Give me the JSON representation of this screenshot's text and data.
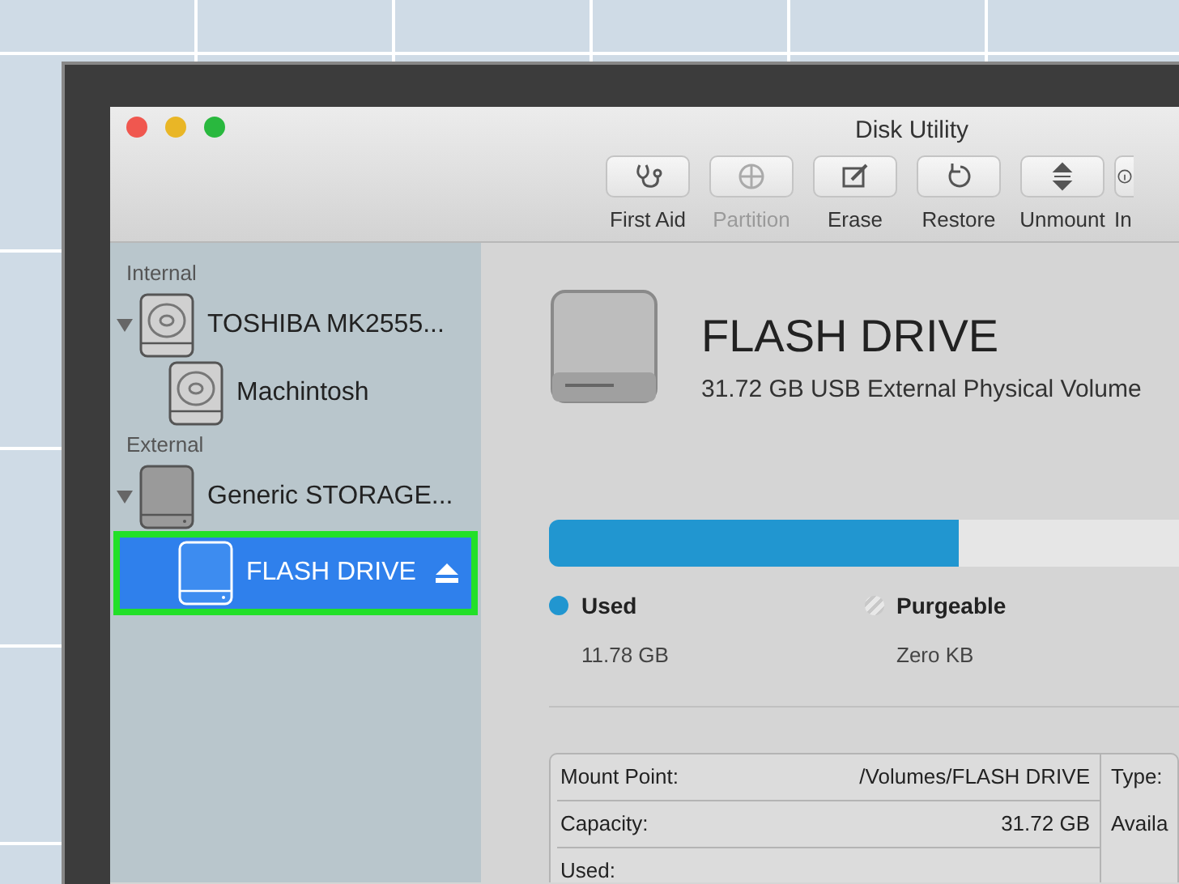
{
  "window": {
    "title": "Disk Utility"
  },
  "toolbar": [
    {
      "label": "First Aid",
      "kind": "firstaid",
      "disabled": false
    },
    {
      "label": "Partition",
      "kind": "partition",
      "disabled": true
    },
    {
      "label": "Erase",
      "kind": "erase",
      "disabled": false
    },
    {
      "label": "Restore",
      "kind": "restore",
      "disabled": false
    },
    {
      "label": "Unmount",
      "kind": "unmount",
      "disabled": false
    },
    {
      "label": "In",
      "kind": "info",
      "disabled": false
    }
  ],
  "sidebar": {
    "sections": [
      {
        "heading": "Internal",
        "items": [
          {
            "name": "TOSHIBA MK2555...",
            "kind": "hdd",
            "expanded": true,
            "selected": false,
            "children": [
              {
                "name": "Machintosh",
                "kind": "hdd",
                "selected": false,
                "ejectable": false
              }
            ]
          }
        ]
      },
      {
        "heading": "External",
        "items": [
          {
            "name": "Generic STORAGE...",
            "kind": "external",
            "expanded": true,
            "selected": false,
            "children": [
              {
                "name": "FLASH DRIVE",
                "kind": "external",
                "selected": true,
                "ejectable": true
              }
            ]
          }
        ]
      }
    ]
  },
  "volume": {
    "name": "FLASH DRIVE",
    "description": "31.72 GB USB External Physical Volume",
    "usage": {
      "level": 0.65
    },
    "legend": [
      {
        "label": "Used",
        "value": "11.78 GB",
        "kind": "solid",
        "color": "#2196d0"
      },
      {
        "label": "Purgeable",
        "value": "Zero KB",
        "kind": "striped"
      }
    ]
  },
  "info": {
    "rows": [
      {
        "label": "Mount Point:",
        "value": "/Volumes/FLASH DRIVE",
        "label_2": "Type:"
      },
      {
        "label": "Capacity:",
        "value": "31.72 GB",
        "label_2": "Availa"
      },
      {
        "label": "Used:"
      }
    ]
  }
}
